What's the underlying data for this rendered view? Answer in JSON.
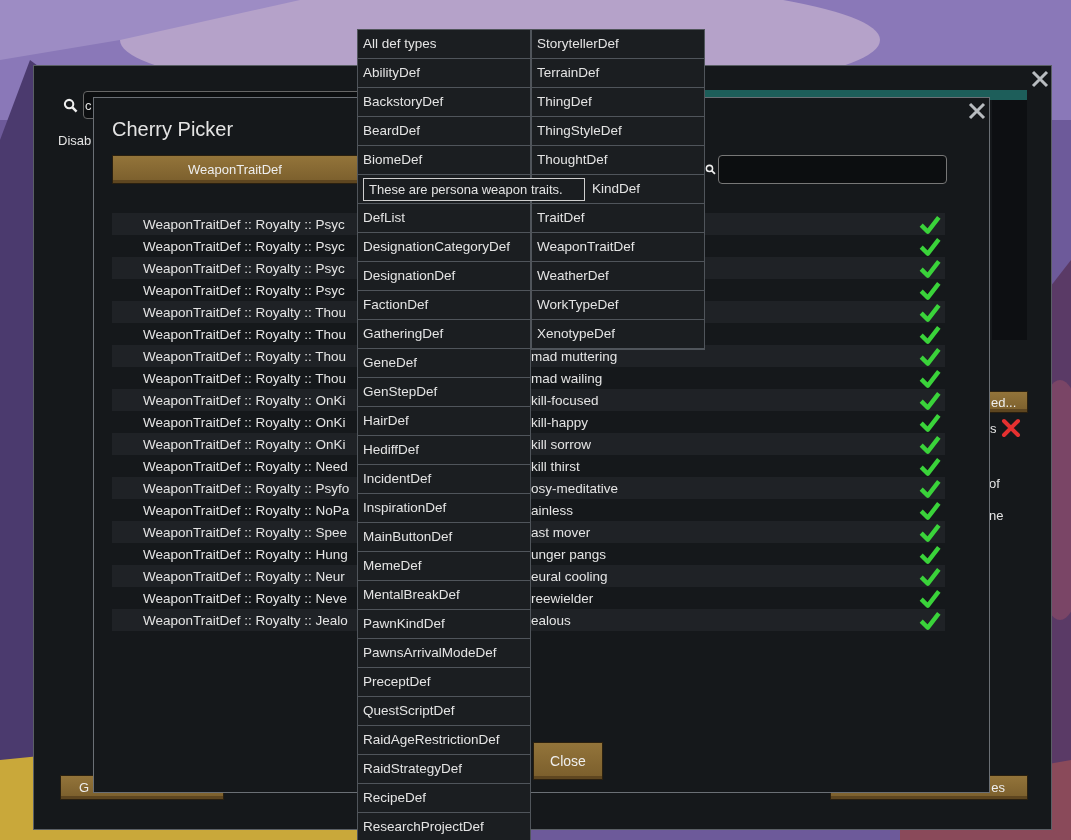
{
  "outer_dialog": {
    "search_value": "c",
    "label": "Disab",
    "side_button": "ed...",
    "side_label": "s",
    "side_checked": false,
    "side_texts": [
      "of",
      "ne"
    ],
    "bottom_buttons": [
      "G",
      "es"
    ]
  },
  "dialog": {
    "title": "Cherry Picker",
    "type_button": "WeaponTraitDef",
    "rows": [
      {
        "left": "WeaponTraitDef :: Royalty :: Psyc",
        "checked": true
      },
      {
        "left": "WeaponTraitDef :: Royalty :: Psyc",
        "checked": true
      },
      {
        "left": "WeaponTraitDef :: Royalty :: Psyc",
        "checked": true
      },
      {
        "left": "WeaponTraitDef :: Royalty :: Psyc",
        "checked": true
      },
      {
        "left": "WeaponTraitDef :: Royalty :: Thou",
        "checked": true
      },
      {
        "left": "WeaponTraitDef :: Royalty :: Thou",
        "checked": true
      },
      {
        "left": "WeaponTraitDef :: Royalty :: Thou",
        "right": "mad muttering",
        "checked": true
      },
      {
        "left": "WeaponTraitDef :: Royalty :: Thou",
        "right": "mad wailing",
        "checked": true
      },
      {
        "left": "WeaponTraitDef :: Royalty :: OnKi",
        "right": "kill-focused",
        "checked": true
      },
      {
        "left": "WeaponTraitDef :: Royalty :: OnKi",
        "right": "kill-happy",
        "checked": true
      },
      {
        "left": "WeaponTraitDef :: Royalty :: OnKi",
        "right": "kill sorrow",
        "checked": true
      },
      {
        "left": "WeaponTraitDef :: Royalty :: Need",
        "right": "kill thirst",
        "checked": true
      },
      {
        "left": "WeaponTraitDef :: Royalty :: Psyfo",
        "right": "osy-meditative",
        "checked": true
      },
      {
        "left": "WeaponTraitDef :: Royalty :: NoPa",
        "right": "ainless",
        "checked": true
      },
      {
        "left": "WeaponTraitDef :: Royalty :: Spee",
        "right": "ast mover",
        "checked": true
      },
      {
        "left": "WeaponTraitDef :: Royalty :: Hung",
        "right": "unger pangs",
        "checked": true
      },
      {
        "left": "WeaponTraitDef :: Royalty :: Neur",
        "right": "eural cooling",
        "checked": true
      },
      {
        "left": "WeaponTraitDef :: Royalty :: Neve",
        "right": "reewielder",
        "checked": true
      },
      {
        "left": "WeaponTraitDef :: Royalty :: Jealo",
        "right": "ealous",
        "checked": true
      }
    ],
    "close_button": "Close"
  },
  "dropdown": {
    "column_1": [
      {
        "kind": "item",
        "label": "All def types"
      },
      {
        "kind": "item",
        "label": "AbilityDef"
      },
      {
        "kind": "item",
        "label": "BackstoryDef"
      },
      {
        "kind": "item",
        "label": "BeardDef"
      },
      {
        "kind": "item",
        "label": "BiomeDef"
      },
      {
        "kind": "tooltip",
        "text": "These are persona weapon traits."
      },
      {
        "kind": "item",
        "label": "DefList"
      },
      {
        "kind": "item",
        "label": "DesignationCategoryDef"
      },
      {
        "kind": "item",
        "label": "DesignationDef"
      },
      {
        "kind": "item",
        "label": "FactionDef"
      },
      {
        "kind": "item",
        "label": "GatheringDef"
      },
      {
        "kind": "item",
        "label": "GeneDef"
      },
      {
        "kind": "item",
        "label": "GenStepDef"
      },
      {
        "kind": "item",
        "label": "HairDef"
      },
      {
        "kind": "item",
        "label": "HediffDef"
      },
      {
        "kind": "item",
        "label": "IncidentDef"
      },
      {
        "kind": "item",
        "label": "InspirationDef"
      },
      {
        "kind": "item",
        "label": "MainButtonDef"
      },
      {
        "kind": "item",
        "label": "MemeDef"
      },
      {
        "kind": "item",
        "label": "MentalBreakDef"
      },
      {
        "kind": "item",
        "label": "PawnKindDef"
      },
      {
        "kind": "item",
        "label": "PawnsArrivalModeDef"
      },
      {
        "kind": "item",
        "label": "PreceptDef"
      },
      {
        "kind": "item",
        "label": "QuestScriptDef"
      },
      {
        "kind": "item",
        "label": "RaidAgeRestrictionDef"
      },
      {
        "kind": "item",
        "label": "RaidStrategyDef"
      },
      {
        "kind": "item",
        "label": "RecipeDef"
      },
      {
        "kind": "item",
        "label": "ResearchProjectDef"
      }
    ],
    "column_2": [
      {
        "kind": "item",
        "label": "StorytellerDef"
      },
      {
        "kind": "item",
        "label": "TerrainDef"
      },
      {
        "kind": "item",
        "label": "ThingDef"
      },
      {
        "kind": "item",
        "label": "ThingStyleDef"
      },
      {
        "kind": "item",
        "label": "ThoughtDef"
      },
      {
        "kind": "covered",
        "label": "KindDef"
      },
      {
        "kind": "item",
        "label": "TraitDef"
      },
      {
        "kind": "item",
        "label": "WeaponTraitDef"
      },
      {
        "kind": "item",
        "label": "WeatherDef"
      },
      {
        "kind": "item",
        "label": "WorkTypeDef"
      },
      {
        "kind": "item",
        "label": "XenotypeDef"
      }
    ]
  }
}
